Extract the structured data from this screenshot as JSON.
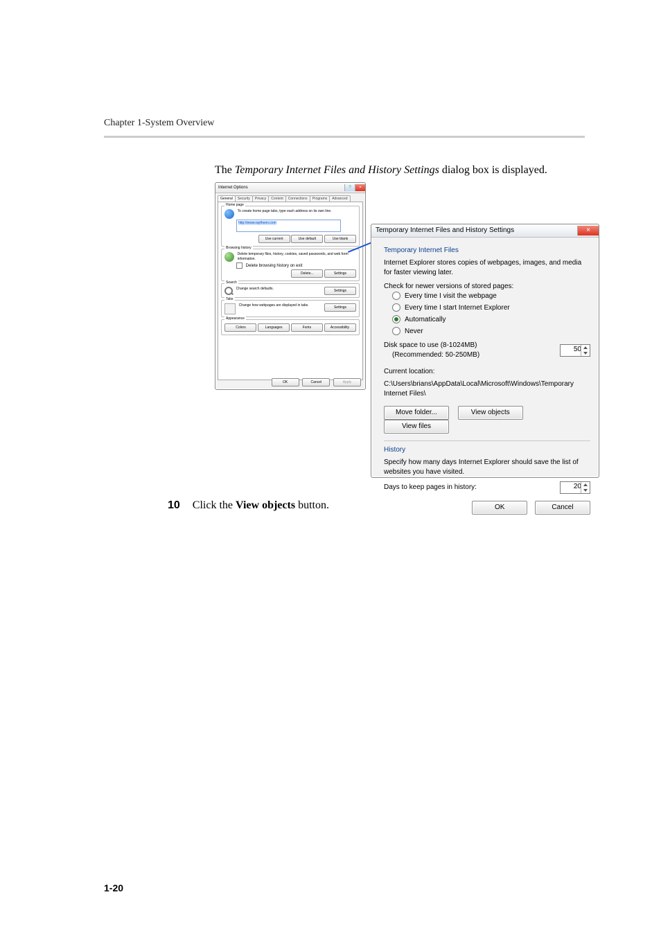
{
  "chapter_header": "Chapter 1-System Overview",
  "intro": {
    "pre": "The ",
    "em": "Temporary Internet Files and History Settings",
    "post": " dialog box is displayed."
  },
  "io": {
    "title": "Internet Options",
    "tabs": [
      "General",
      "Security",
      "Privacy",
      "Content",
      "Connections",
      "Programs",
      "Advanced"
    ],
    "home": {
      "legend": "Home page",
      "text": "To create home page tabs, type each address on its own line.",
      "url": "http://www.raytheon.com",
      "use_current": "Use current",
      "use_default": "Use default",
      "use_blank": "Use blank"
    },
    "hist": {
      "legend": "Browsing history",
      "text": "Delete temporary files, history, cookies, saved passwords, and web form information.",
      "chk": "Delete browsing history on exit",
      "delete_btn": "Delete...",
      "settings_btn": "Settings"
    },
    "search": {
      "legend": "Search",
      "text": "Change search defaults.",
      "btn": "Settings"
    },
    "tabs_section": {
      "legend": "Tabs",
      "text": "Change how webpages are displayed in tabs.",
      "btn": "Settings"
    },
    "appearance": {
      "legend": "Appearance",
      "colors": "Colors",
      "languages": "Languages",
      "fonts": "Fonts",
      "accessibility": "Accessibility"
    },
    "bottom": {
      "ok": "OK",
      "cancel": "Cancel",
      "apply": "Apply"
    }
  },
  "tif": {
    "title": "Temporary Internet Files and History Settings",
    "sect1": "Temporary Internet Files",
    "stores": "Internet Explorer stores copies of webpages, images, and media for faster viewing later.",
    "check": "Check for newer versions of stored pages:",
    "opt1": "Every time I visit the webpage",
    "opt2": "Every time I start Internet Explorer",
    "opt3": "Automatically",
    "opt4": "Never",
    "disk_label": "Disk space to use (8-1024MB)",
    "disk_rec": "(Recommended: 50-250MB)",
    "disk_value": "50",
    "curloc_label": "Current location:",
    "curloc": "C:\\Users\\brians\\AppData\\Local\\Microsoft\\Windows\\Temporary Internet Files\\",
    "move": "Move folder...",
    "view_objects": "View objects",
    "view_files": "View files",
    "sect2": "History",
    "hist_text": "Specify how many days Internet Explorer should save the list of websites you have visited.",
    "days_label": "Days to keep pages in history:",
    "days_value": "20",
    "ok": "OK",
    "cancel": "Cancel"
  },
  "step": {
    "num": "10",
    "text_pre": "Click the ",
    "bold": "View objects",
    "text_post": " button."
  },
  "page_number": "1-20"
}
